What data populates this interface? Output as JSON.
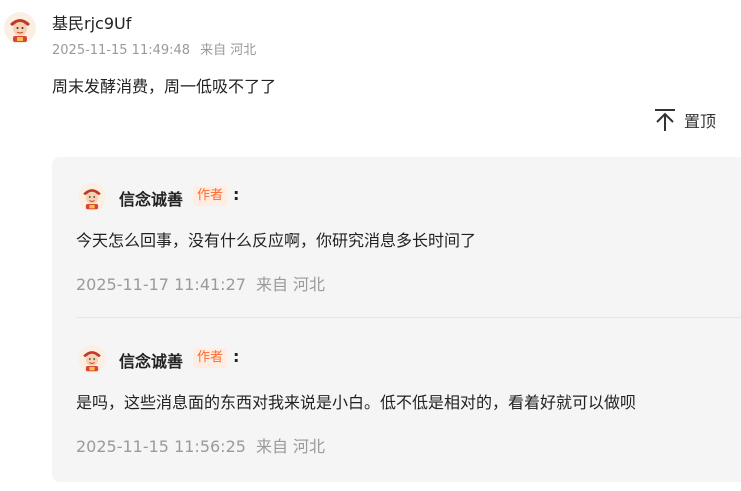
{
  "comment": {
    "username": "基民rjc9Uf",
    "timestamp": "2025-11-15 11:49:48",
    "location": "来自 河北",
    "text": "周末发酵消费，周一低吸不了了",
    "pin_label": "置顶"
  },
  "replies": [
    {
      "author": "信念诚善",
      "badge": "作者",
      "colon": ":",
      "text": "今天怎么回事，没有什么反应啊，你研究消息多长时间了",
      "timestamp": "2025-11-17 11:41:27",
      "location": "来自 河北"
    },
    {
      "author": "信念诚善",
      "badge": "作者",
      "colon": ":",
      "text": "是吗，这些消息面的东西对我来说是小白。低不低是相对的，看着好就可以做呗",
      "timestamp": "2025-11-15 11:56:25",
      "location": "来自 河北"
    }
  ],
  "colors": {
    "badge_text": "#ff6a2b",
    "badge_bg": "#ffece3",
    "meta_text": "#9a9a9a",
    "reply_bg": "#f5f5f6"
  }
}
